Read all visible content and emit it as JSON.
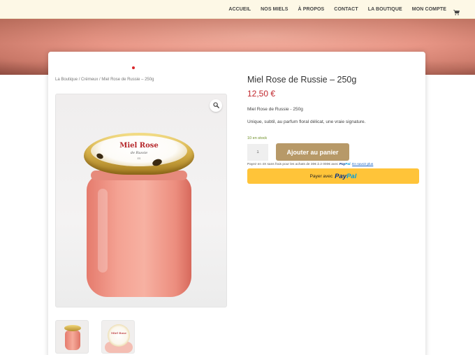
{
  "nav": {
    "items": [
      {
        "label": "ACCUEIL"
      },
      {
        "label": "NOS MIELS"
      },
      {
        "label": "À PROPOS"
      },
      {
        "label": "CONTACT"
      },
      {
        "label": "LA BOUTIQUE"
      },
      {
        "label": "MON COMPTE"
      }
    ],
    "cart_icon": "cart-icon"
  },
  "breadcrumb": {
    "items": [
      "La Boutique",
      "Crémeux",
      "Miel Rose de Russie – 250g"
    ],
    "separator": " / "
  },
  "gallery": {
    "zoom_icon": "magnifier-icon",
    "jar_label": {
      "title": "Miel Rose",
      "subtitle": "de Russie",
      "footer": "ES"
    }
  },
  "product": {
    "title": "Miel Rose de Russie – 250g",
    "price": "12,50 €",
    "short_description": "Miel Rose de Russie - 250g",
    "tagline": "Unique, subtil, au parfum floral délicat, une vraie signature.",
    "stock": "10 en stock",
    "quantity": "1",
    "add_to_cart_label": "Ajouter au panier"
  },
  "paypal": {
    "pay_later_text": "Payez en 4X sans frais pour les achats de 30€ à 2 000€ avec",
    "brand_a": "Pay",
    "brand_b": "Pal",
    "learn_more": "En savoir plus",
    "button_prefix": "Payer avec"
  },
  "colors": {
    "header_bg": "#fdf8e6",
    "price": "#c1272d",
    "stock": "#6b8e23",
    "add_to_cart": "#b79968",
    "paypal_button": "#ffc439"
  }
}
